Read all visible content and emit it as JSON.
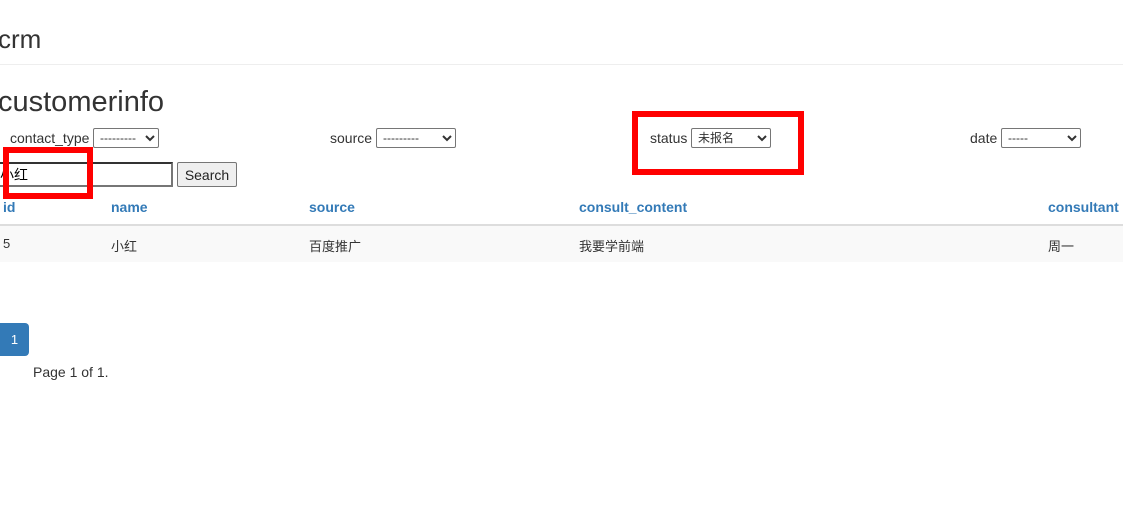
{
  "header": {
    "brand": "crm"
  },
  "page_title": "customerinfo",
  "filters": [
    {
      "label": "contact_type",
      "value": "---------"
    },
    {
      "label": "source",
      "value": "---------"
    },
    {
      "label": "status",
      "value": "未报名"
    },
    {
      "label": "date",
      "value": "-----"
    }
  ],
  "search": {
    "value": "小红",
    "button": "Search"
  },
  "table": {
    "columns": [
      "id",
      "name",
      "source",
      "consult_content",
      "consultant"
    ],
    "rows": [
      [
        "5",
        "小红",
        "百度推广",
        "我要学前端",
        "周一"
      ]
    ]
  },
  "pagination": {
    "current": "1",
    "info": "Page 1 of 1."
  },
  "annotation_color": "#ff0000"
}
